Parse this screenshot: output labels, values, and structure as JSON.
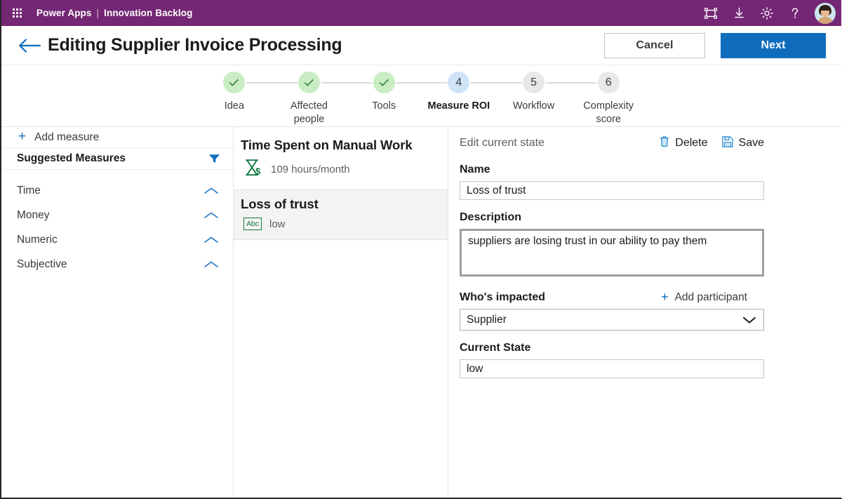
{
  "suitebar": {
    "waffle_label": "app-launcher",
    "product": "Power Apps",
    "separator": "|",
    "app_name": "Innovation Backlog",
    "icons": [
      {
        "name": "screen-frame-icon",
        "glyph": "frame"
      },
      {
        "name": "download-icon",
        "glyph": "download"
      },
      {
        "name": "gear-icon",
        "glyph": "gear"
      },
      {
        "name": "help-icon",
        "glyph": "question"
      }
    ],
    "avatar_label": "user-avatar",
    "bg_color": "#742774"
  },
  "header": {
    "back_label": "back-arrow",
    "title": "Editing Supplier Invoice Processing",
    "cancel_label": "Cancel",
    "next_label": "Next",
    "primary_color": "#0f6cbd"
  },
  "stepper": {
    "steps": [
      {
        "number": "1",
        "label": "Idea",
        "state": "done"
      },
      {
        "number": "2",
        "label": "Affected people",
        "state": "done"
      },
      {
        "number": "3",
        "label": "Tools",
        "state": "done"
      },
      {
        "number": "4",
        "label": "Measure ROI",
        "state": "current"
      },
      {
        "number": "5",
        "label": "Workflow",
        "state": "todo"
      },
      {
        "number": "6",
        "label": "Complexity score",
        "state": "todo"
      }
    ],
    "done_color": "#c9ecc4",
    "current_color": "#cfe4f7",
    "todo_color": "#e8e8e8"
  },
  "sidebar": {
    "add_measure_label": "Add measure",
    "suggested_title": "Suggested Measures",
    "filter_icon": "filter-icon",
    "categories": [
      {
        "label": "Time"
      },
      {
        "label": "Money"
      },
      {
        "label": "Numeric"
      },
      {
        "label": "Subjective"
      }
    ]
  },
  "measures": {
    "cards": [
      {
        "title": "Time Spent on Manual Work",
        "icon": "hourglass-dollar-icon",
        "value": "109 hours/month",
        "selected": false
      },
      {
        "title": "Loss of trust",
        "icon": "abc-icon",
        "icon_text": "Abc",
        "value": "low",
        "selected": true
      }
    ]
  },
  "details": {
    "section_label": "Edit current state",
    "delete_label": "Delete",
    "save_label": "Save",
    "name_label": "Name",
    "name_value": "Loss of trust",
    "name_placeholder": "Name",
    "description_label": "Description",
    "description_value": "suppliers are losing trust in our ability to pay them",
    "description_placeholder": "Description",
    "impacted_label": "Who's impacted",
    "add_participant_label": "Add participant",
    "impacted_value": "Supplier",
    "impacted_options": [
      "Supplier"
    ],
    "current_state_label": "Current State",
    "current_state_value": "low",
    "current_state_placeholder": "Current State"
  }
}
